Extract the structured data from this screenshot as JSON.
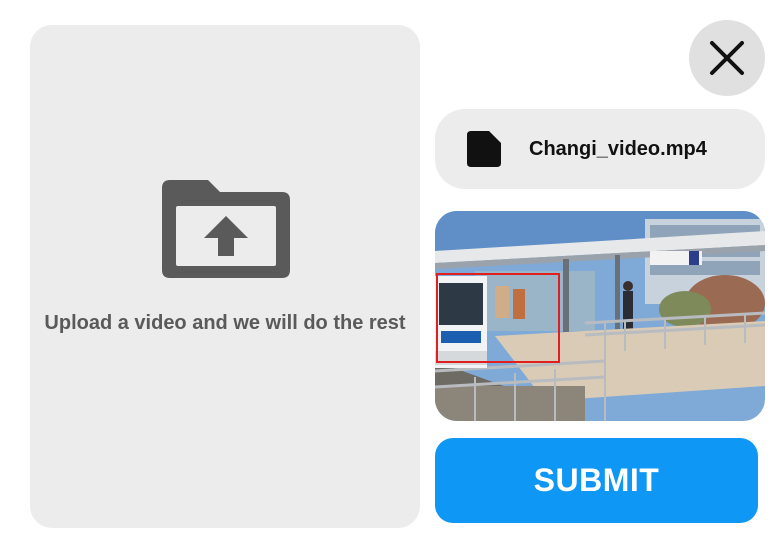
{
  "upload": {
    "prompt": "Upload a video and we will do the rest",
    "icon": "folder-upload-icon"
  },
  "close": {
    "icon": "close-icon"
  },
  "file": {
    "name": "Changi_video.mp4",
    "icon": "file-icon"
  },
  "preview": {
    "icon": "video-thumbnail"
  },
  "submit": {
    "label": "SUBMIT"
  },
  "colors": {
    "accent": "#0e97f4",
    "panel": "#ececec",
    "icon_gray": "#5a5a5a",
    "detection_box": "#e02020"
  }
}
